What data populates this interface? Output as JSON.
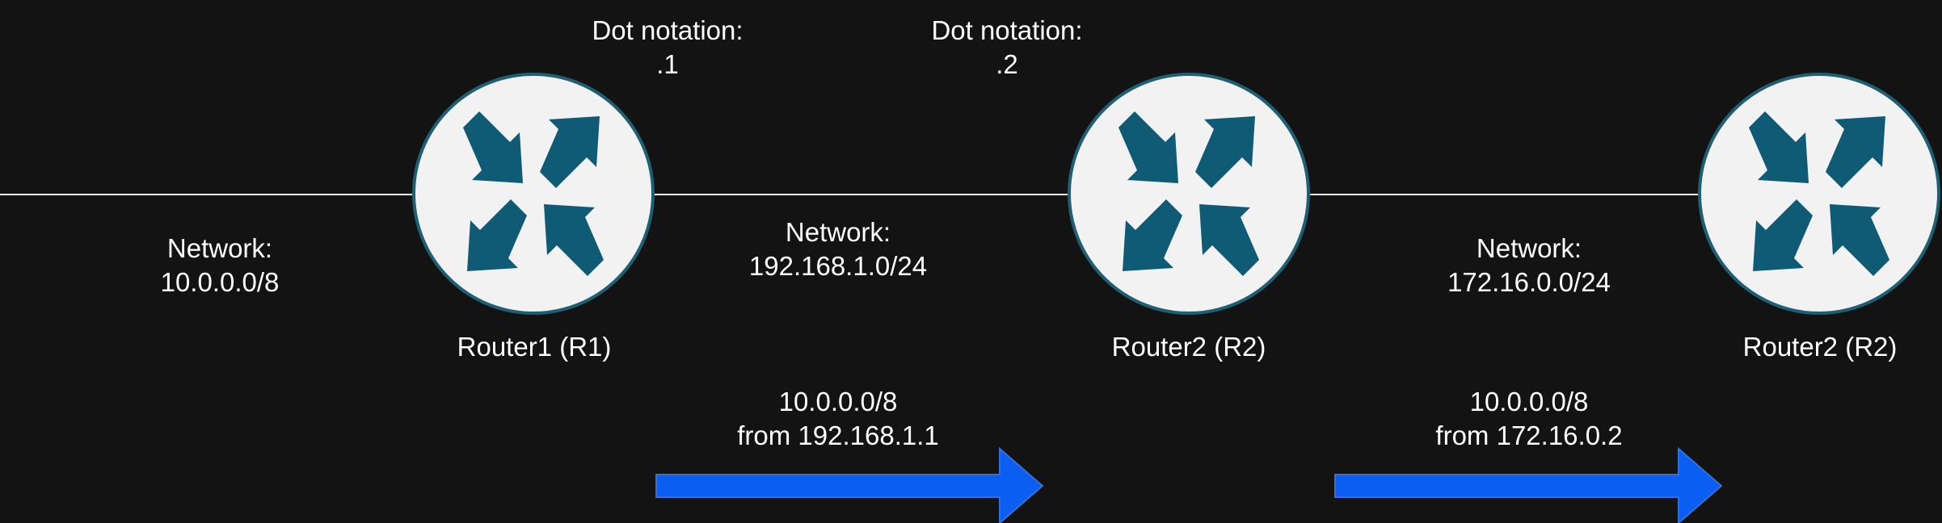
{
  "colors": {
    "background": "#131313",
    "link": "#ffffff",
    "router_fill": "#f2f2f2",
    "router_stroke": "#1f5f73",
    "router_arrows": "#0f5a74",
    "flow_arrow_fill": "#0a5ff2",
    "flow_arrow_stroke": "#3a6fd0",
    "text": "#ffffff"
  },
  "routers": [
    {
      "id": "r1",
      "label": "Router1 (R1)",
      "icon": "router-icon"
    },
    {
      "id": "r2",
      "label": "Router2 (R2)",
      "icon": "router-icon"
    },
    {
      "id": "r3",
      "label": "Router2 (R2)",
      "icon": "router-icon"
    }
  ],
  "networks": [
    {
      "title": "Network:",
      "cidr": "10.0.0.0/8"
    },
    {
      "title": "Network:",
      "cidr": "192.168.1.0/24"
    },
    {
      "title": "Network:",
      "cidr": "172.16.0.0/24"
    }
  ],
  "dot_notations": [
    {
      "title": "Dot notation:",
      "value": ".1"
    },
    {
      "title": "Dot notation:",
      "value": ".2"
    }
  ],
  "route_advertisements": [
    {
      "prefix": "10.0.0.0/8",
      "source": "from 192.168.1.1"
    },
    {
      "prefix": "10.0.0.0/8",
      "source": "from 172.16.0.2"
    }
  ]
}
